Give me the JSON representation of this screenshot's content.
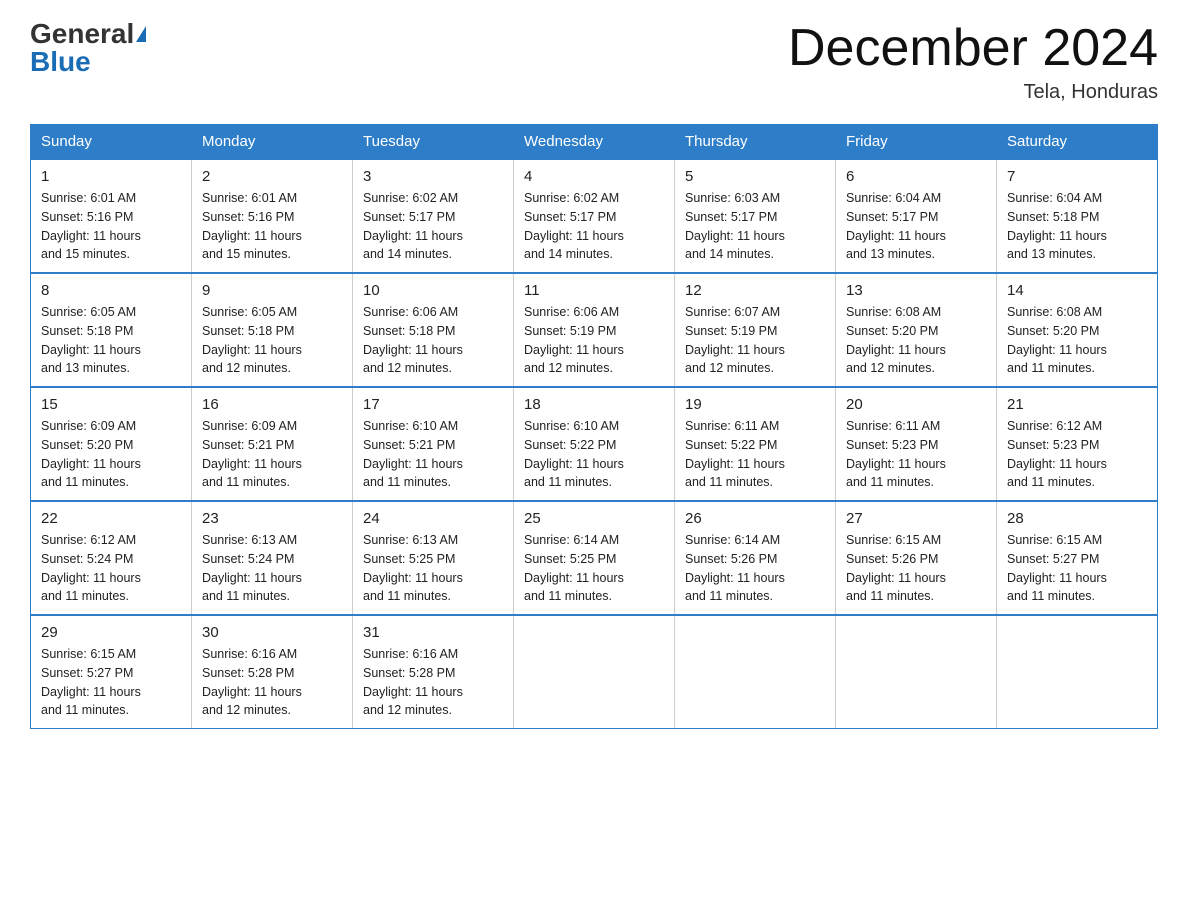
{
  "header": {
    "logo_general": "General",
    "logo_blue": "Blue",
    "month_title": "December 2024",
    "location": "Tela, Honduras"
  },
  "days_of_week": [
    "Sunday",
    "Monday",
    "Tuesday",
    "Wednesday",
    "Thursday",
    "Friday",
    "Saturday"
  ],
  "weeks": [
    [
      {
        "day": "1",
        "sunrise": "6:01 AM",
        "sunset": "5:16 PM",
        "daylight": "11 hours and 15 minutes."
      },
      {
        "day": "2",
        "sunrise": "6:01 AM",
        "sunset": "5:16 PM",
        "daylight": "11 hours and 15 minutes."
      },
      {
        "day": "3",
        "sunrise": "6:02 AM",
        "sunset": "5:17 PM",
        "daylight": "11 hours and 14 minutes."
      },
      {
        "day": "4",
        "sunrise": "6:02 AM",
        "sunset": "5:17 PM",
        "daylight": "11 hours and 14 minutes."
      },
      {
        "day": "5",
        "sunrise": "6:03 AM",
        "sunset": "5:17 PM",
        "daylight": "11 hours and 14 minutes."
      },
      {
        "day": "6",
        "sunrise": "6:04 AM",
        "sunset": "5:17 PM",
        "daylight": "11 hours and 13 minutes."
      },
      {
        "day": "7",
        "sunrise": "6:04 AM",
        "sunset": "5:18 PM",
        "daylight": "11 hours and 13 minutes."
      }
    ],
    [
      {
        "day": "8",
        "sunrise": "6:05 AM",
        "sunset": "5:18 PM",
        "daylight": "11 hours and 13 minutes."
      },
      {
        "day": "9",
        "sunrise": "6:05 AM",
        "sunset": "5:18 PM",
        "daylight": "11 hours and 12 minutes."
      },
      {
        "day": "10",
        "sunrise": "6:06 AM",
        "sunset": "5:18 PM",
        "daylight": "11 hours and 12 minutes."
      },
      {
        "day": "11",
        "sunrise": "6:06 AM",
        "sunset": "5:19 PM",
        "daylight": "11 hours and 12 minutes."
      },
      {
        "day": "12",
        "sunrise": "6:07 AM",
        "sunset": "5:19 PM",
        "daylight": "11 hours and 12 minutes."
      },
      {
        "day": "13",
        "sunrise": "6:08 AM",
        "sunset": "5:20 PM",
        "daylight": "11 hours and 12 minutes."
      },
      {
        "day": "14",
        "sunrise": "6:08 AM",
        "sunset": "5:20 PM",
        "daylight": "11 hours and 11 minutes."
      }
    ],
    [
      {
        "day": "15",
        "sunrise": "6:09 AM",
        "sunset": "5:20 PM",
        "daylight": "11 hours and 11 minutes."
      },
      {
        "day": "16",
        "sunrise": "6:09 AM",
        "sunset": "5:21 PM",
        "daylight": "11 hours and 11 minutes."
      },
      {
        "day": "17",
        "sunrise": "6:10 AM",
        "sunset": "5:21 PM",
        "daylight": "11 hours and 11 minutes."
      },
      {
        "day": "18",
        "sunrise": "6:10 AM",
        "sunset": "5:22 PM",
        "daylight": "11 hours and 11 minutes."
      },
      {
        "day": "19",
        "sunrise": "6:11 AM",
        "sunset": "5:22 PM",
        "daylight": "11 hours and 11 minutes."
      },
      {
        "day": "20",
        "sunrise": "6:11 AM",
        "sunset": "5:23 PM",
        "daylight": "11 hours and 11 minutes."
      },
      {
        "day": "21",
        "sunrise": "6:12 AM",
        "sunset": "5:23 PM",
        "daylight": "11 hours and 11 minutes."
      }
    ],
    [
      {
        "day": "22",
        "sunrise": "6:12 AM",
        "sunset": "5:24 PM",
        "daylight": "11 hours and 11 minutes."
      },
      {
        "day": "23",
        "sunrise": "6:13 AM",
        "sunset": "5:24 PM",
        "daylight": "11 hours and 11 minutes."
      },
      {
        "day": "24",
        "sunrise": "6:13 AM",
        "sunset": "5:25 PM",
        "daylight": "11 hours and 11 minutes."
      },
      {
        "day": "25",
        "sunrise": "6:14 AM",
        "sunset": "5:25 PM",
        "daylight": "11 hours and 11 minutes."
      },
      {
        "day": "26",
        "sunrise": "6:14 AM",
        "sunset": "5:26 PM",
        "daylight": "11 hours and 11 minutes."
      },
      {
        "day": "27",
        "sunrise": "6:15 AM",
        "sunset": "5:26 PM",
        "daylight": "11 hours and 11 minutes."
      },
      {
        "day": "28",
        "sunrise": "6:15 AM",
        "sunset": "5:27 PM",
        "daylight": "11 hours and 11 minutes."
      }
    ],
    [
      {
        "day": "29",
        "sunrise": "6:15 AM",
        "sunset": "5:27 PM",
        "daylight": "11 hours and 11 minutes."
      },
      {
        "day": "30",
        "sunrise": "6:16 AM",
        "sunset": "5:28 PM",
        "daylight": "11 hours and 12 minutes."
      },
      {
        "day": "31",
        "sunrise": "6:16 AM",
        "sunset": "5:28 PM",
        "daylight": "11 hours and 12 minutes."
      },
      null,
      null,
      null,
      null
    ]
  ],
  "labels": {
    "sunrise": "Sunrise:",
    "sunset": "Sunset:",
    "daylight": "Daylight:"
  }
}
